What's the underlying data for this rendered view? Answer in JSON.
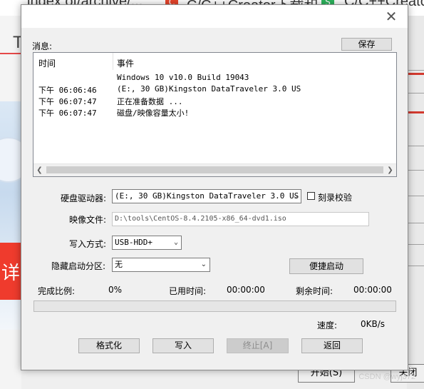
{
  "background": {
    "tabs": [
      "index of/archive/...",
      "C",
      "C/C++Creator下载和...",
      "S",
      "C/C++Creator M"
    ],
    "left_letter": "T",
    "left_banner_char": "详",
    "bottom_buttons": [
      "开始(S)",
      "关闭"
    ],
    "watermark": "CSDN @wyj372"
  },
  "dialog": {
    "close_glyph": "✕",
    "messages_label": "消息:",
    "save_button": "保存",
    "log": {
      "col_time": "时间",
      "col_event": "事件",
      "rows": [
        {
          "time": "",
          "event": "Windows 10 v10.0 Build 19043"
        },
        {
          "time": "下午 06:06:46",
          "event": "(E:, 30 GB)Kingston DataTraveler 3.0 US"
        },
        {
          "time": "下午 06:07:47",
          "event": "正在准备数据 ..."
        },
        {
          "time": "下午 06:07:47",
          "event": "磁盘/映像容量太小!"
        }
      ]
    },
    "drive_label": "硬盘驱动器:",
    "drive_value": "(E:, 30 GB)Kingston DataTraveler 3.0 US",
    "verify_label": "刻录校验",
    "verify_checked": false,
    "image_label": "映像文件:",
    "image_value": "D:\\tools\\CentOS-8.4.2105-x86_64-dvd1.iso",
    "write_method_label": "写入方式:",
    "write_method_value": "USB-HDD+",
    "hidden_partition_label": "隐藏启动分区:",
    "hidden_partition_value": "无",
    "quick_boot_button": "便捷启动",
    "progress_label": "完成比例:",
    "progress_value": "0%",
    "progress_fraction": 0,
    "elapsed_label": "已用时间:",
    "elapsed_value": "00:00:00",
    "remaining_label": "剩余时间:",
    "remaining_value": "00:00:00",
    "speed_label": "速度:",
    "speed_value": "0KB/s",
    "buttons": {
      "format": "格式化",
      "write": "写入",
      "abort": "终止[A]",
      "back": "返回"
    }
  }
}
